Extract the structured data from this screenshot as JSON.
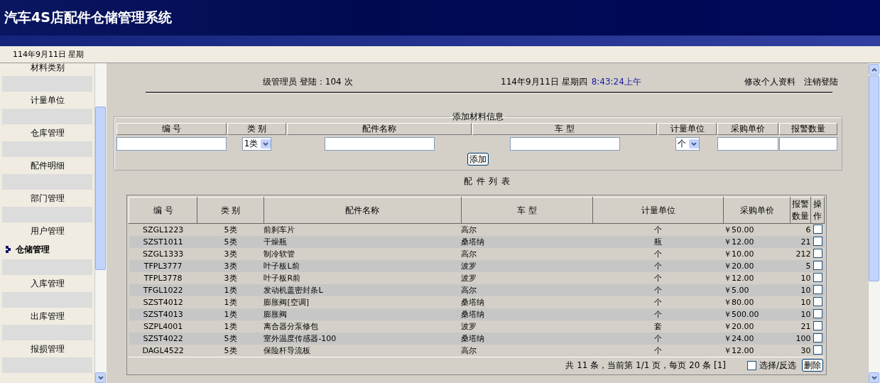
{
  "window": {
    "title": "汽车4S店配件仓储管理系统"
  },
  "top_bar": {
    "date": "114年9月11日 星期"
  },
  "sidebar": {
    "items": [
      {
        "label": "材料类别",
        "kind": "item"
      },
      {
        "label": "计量单位",
        "kind": "item"
      },
      {
        "label": "仓库管理",
        "kind": "item"
      },
      {
        "label": "配件明细",
        "kind": "item"
      },
      {
        "label": "部门管理",
        "kind": "item"
      },
      {
        "label": "用户管理",
        "kind": "item"
      },
      {
        "label": "仓储管理",
        "kind": "group"
      },
      {
        "label": "入库管理",
        "kind": "item"
      },
      {
        "label": "出库管理",
        "kind": "item"
      },
      {
        "label": "报损管理",
        "kind": "item"
      }
    ]
  },
  "info_bar": {
    "user": "级管理员 登陆：104 次",
    "date": "114年9月11日 星期四",
    "time": "8:43:24上午",
    "links": [
      "修改个人资料",
      "注销登陆"
    ]
  },
  "add_form": {
    "legend": "添加材料信息",
    "columns": [
      "编 号",
      "类 别",
      "配件名称",
      "车 型",
      "计量单位",
      "采购单价",
      "报警数量"
    ],
    "fields": [
      {
        "kind": "text"
      },
      {
        "kind": "select",
        "value": "1类"
      },
      {
        "kind": "text"
      },
      {
        "kind": "text"
      },
      {
        "kind": "select",
        "value": "个"
      },
      {
        "kind": "text"
      },
      {
        "kind": "text"
      }
    ],
    "button": "添加"
  },
  "list": {
    "title": "配 件 列 表",
    "columns": [
      "编 号",
      "类 别",
      "配件名称",
      "车 型",
      "计量单位",
      "采购单价",
      "报警数量",
      "操作"
    ],
    "rows": [
      {
        "cells": [
          "SZGL1223",
          "5类",
          "前刹车片",
          "高尔",
          "个",
          "￥50.00",
          "6"
        ],
        "checked": false
      },
      {
        "cells": [
          "SZST1011",
          "5类",
          "干燥瓶",
          "桑塔纳",
          "瓶",
          "￥12.00",
          "21"
        ],
        "checked": false
      },
      {
        "cells": [
          "SZGL1333",
          "3类",
          "制冷软管",
          "高尔",
          "个",
          "￥10.00",
          "212"
        ],
        "checked": false
      },
      {
        "cells": [
          "TFPL3777",
          "3类",
          "叶子板L前",
          "波罗",
          "个",
          "￥20.00",
          "5"
        ],
        "checked": false
      },
      {
        "cells": [
          "TFPL3778",
          "3类",
          "叶子板R前",
          "波罗",
          "个",
          "￥12.00",
          "10"
        ],
        "checked": false
      },
      {
        "cells": [
          "TFGL1022",
          "1类",
          "发动机盖密封条L",
          "高尔",
          "个",
          "￥5.00",
          "10"
        ],
        "checked": false
      },
      {
        "cells": [
          "SZST4012",
          "1类",
          "膨胀阀[空调]",
          "桑塔纳",
          "个",
          "￥80.00",
          "10"
        ],
        "checked": false
      },
      {
        "cells": [
          "SZST4013",
          "1类",
          "膨胀阀",
          "桑塔纳",
          "个",
          "￥500.00",
          "10"
        ],
        "checked": false
      },
      {
        "cells": [
          "SZPL4001",
          "1类",
          "离合器分泵修包",
          "波罗",
          "套",
          "￥20.00",
          "21"
        ],
        "checked": false
      },
      {
        "cells": [
          "SZST4022",
          "5类",
          "室外温度传感器-100",
          "桑塔纳",
          "个",
          "￥24.00",
          "100"
        ],
        "checked": false
      },
      {
        "cells": [
          "DAGL4522",
          "5类",
          "保险杆导流板",
          "高尔",
          "个",
          "￥12.00",
          "30"
        ],
        "checked": false
      }
    ],
    "pager": "共 11 条，当前第 1/1 页，每页 20 条 [1]",
    "select_all": {
      "label": "选择/反选",
      "checked": false
    },
    "delete_button": "删除"
  }
}
